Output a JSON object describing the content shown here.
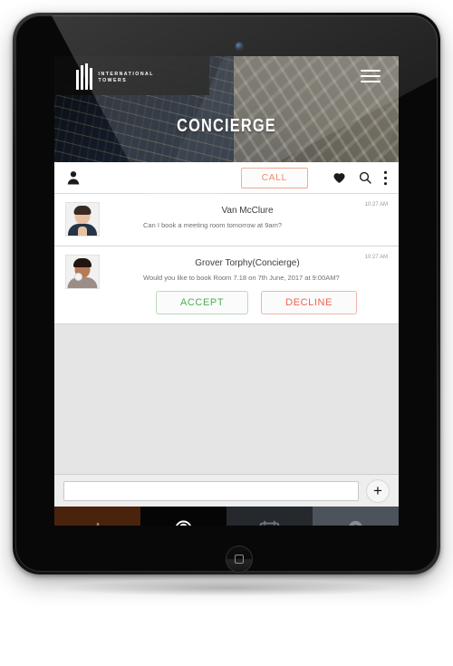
{
  "device": {
    "type": "tablet",
    "camera_icon": "camera-dot",
    "home_button_icon": "home-square-icon"
  },
  "app": {
    "logo": {
      "icon": "international-towers-logo",
      "line1": "INTERNATIONAL",
      "line2": "TOWERS"
    },
    "menu_icon": "hamburger-menu-icon",
    "banner_title": "CONCIERGE"
  },
  "action_bar": {
    "profile_icon": "person-icon",
    "call_label": "CALL",
    "favorite_icon": "heart-icon",
    "search_icon": "search-icon",
    "overflow_icon": "more-vertical-icon"
  },
  "messages": [
    {
      "name": "Van McClure",
      "text": "Can I book a meeting room tomorrow at 9am?",
      "time": "10:27 AM",
      "avatar_icon": "avatar-van-mcclure",
      "actions": []
    },
    {
      "name": "Grover Torphy(Concierge)",
      "text": "Would you like to book Room 7.18 on 7th June, 2017 at 9:00AM?",
      "time": "10:27 AM",
      "avatar_icon": "avatar-grover-torphy",
      "actions": [
        {
          "label": "ACCEPT",
          "kind": "accept"
        },
        {
          "label": "DECLINE",
          "kind": "decline"
        }
      ]
    }
  ],
  "composer": {
    "value": "",
    "placeholder": "",
    "add_icon": "plus-icon"
  },
  "bottom_nav": [
    {
      "icon": "plus-icon",
      "name": "add",
      "active": false,
      "bg": "#4a230c",
      "fg": "#9a8274"
    },
    {
      "icon": "concierge-icon",
      "name": "concierge",
      "active": true,
      "bg": "#050505",
      "fg": "#ffffff"
    },
    {
      "icon": "calendar-icon",
      "name": "calendar",
      "active": false,
      "bg": "#25292e",
      "fg": "#6f7680"
    },
    {
      "icon": "location-icon",
      "name": "location",
      "active": false,
      "bg": "#4c535a",
      "fg": "#868d93"
    }
  ],
  "colors": {
    "accent_call": "#ef8a68",
    "accept_green": "#4caf50",
    "decline_red": "#f4604f",
    "chat_bg": "#e5e5e5",
    "nav_active_bg": "#050505"
  }
}
